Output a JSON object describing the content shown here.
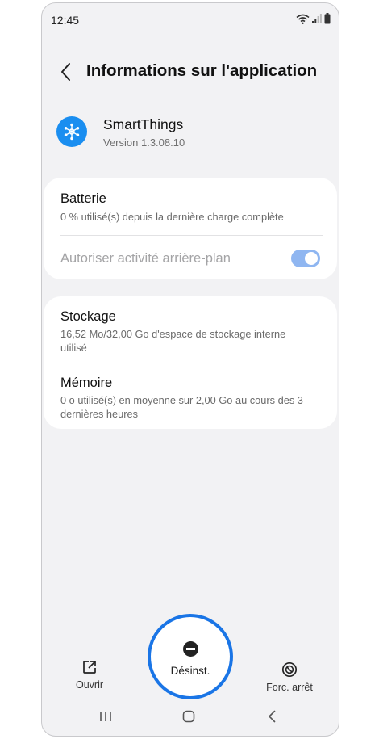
{
  "status_bar": {
    "time": "12:45"
  },
  "header": {
    "title": "Informations sur l'application"
  },
  "app": {
    "name": "SmartThings",
    "version": "Version 1.3.08.10"
  },
  "battery": {
    "title": "Batterie",
    "subtitle": "0 % utilisé(s) depuis la dernière charge complète",
    "background_label": "Autoriser activité arrière-plan",
    "background_enabled": true
  },
  "storage": {
    "title": "Stockage",
    "subtitle": "16,52 Mo/32,00 Go d'espace de stockage interne utilisé"
  },
  "memory": {
    "title": "Mémoire",
    "subtitle": "0 o utilisé(s) en moyenne sur 2,00 Go au cours des 3 dernières heures"
  },
  "actions": {
    "open": "Ouvrir",
    "uninstall": "Désinst.",
    "force_stop": "Forc. arrêt"
  },
  "colors": {
    "accent": "#1a75e6",
    "app_icon": "#1a8ef0",
    "toggle_disabled": "#8fb6f1"
  }
}
